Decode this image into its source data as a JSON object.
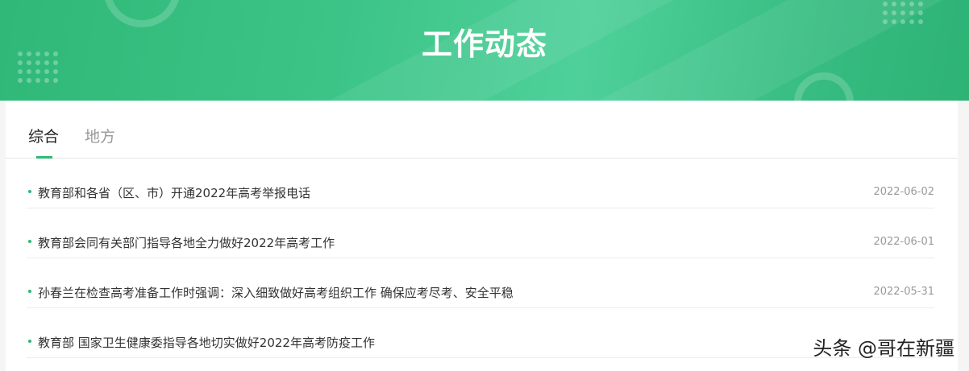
{
  "banner": {
    "title": "工作动态"
  },
  "tabs": [
    {
      "label": "综合",
      "active": true
    },
    {
      "label": "地方",
      "active": false
    }
  ],
  "news": [
    {
      "title": "教育部和各省（区、市）开通2022年高考举报电话",
      "date": "2022-06-02"
    },
    {
      "title": "教育部会同有关部门指导各地全力做好2022年高考工作",
      "date": "2022-06-01"
    },
    {
      "title": "孙春兰在检查高考准备工作时强调：深入细致做好高考组织工作 确保应考尽考、安全平稳",
      "date": "2022-05-31"
    },
    {
      "title": "教育部 国家卫生健康委指导各地切实做好2022年高考防疫工作",
      "date": ""
    }
  ],
  "watermark": "头条 @哥在新疆",
  "colors": {
    "accent": "#2fb877",
    "banner_start": "#2fb877",
    "banner_end": "#2db374"
  }
}
